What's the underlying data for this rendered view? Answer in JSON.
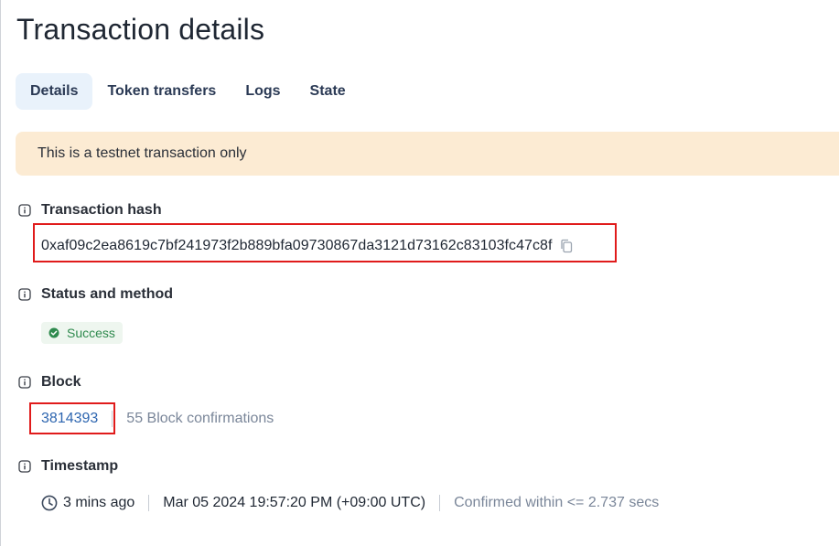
{
  "page": {
    "title": "Transaction details"
  },
  "tabs": [
    {
      "label": "Details",
      "active": true
    },
    {
      "label": "Token transfers",
      "active": false
    },
    {
      "label": "Logs",
      "active": false
    },
    {
      "label": "State",
      "active": false
    }
  ],
  "banner": {
    "text": "This is a testnet transaction only"
  },
  "fields": {
    "hash": {
      "label": "Transaction hash",
      "value": "0xaf09c2ea8619c7bf241973f2b889bfa09730867da3121d73162c83103fc47c8f",
      "icon": "copy-icon"
    },
    "status": {
      "label": "Status and method",
      "value": "Success",
      "icon": "check-circle-icon"
    },
    "block": {
      "label": "Block",
      "number": "3814393",
      "confirmations": "55 Block confirmations"
    },
    "timestamp": {
      "label": "Timestamp",
      "relative": "3 mins ago",
      "absolute": "Mar 05 2024 19:57:20 PM (+09:00 UTC)",
      "confirmed": "Confirmed within <= 2.737 secs",
      "icon": "clock-icon"
    }
  },
  "colors": {
    "accent": "#2e66b0",
    "banner_bg": "#fcebd3",
    "success": "#2f8a4e",
    "highlight": "#e01b1b"
  }
}
